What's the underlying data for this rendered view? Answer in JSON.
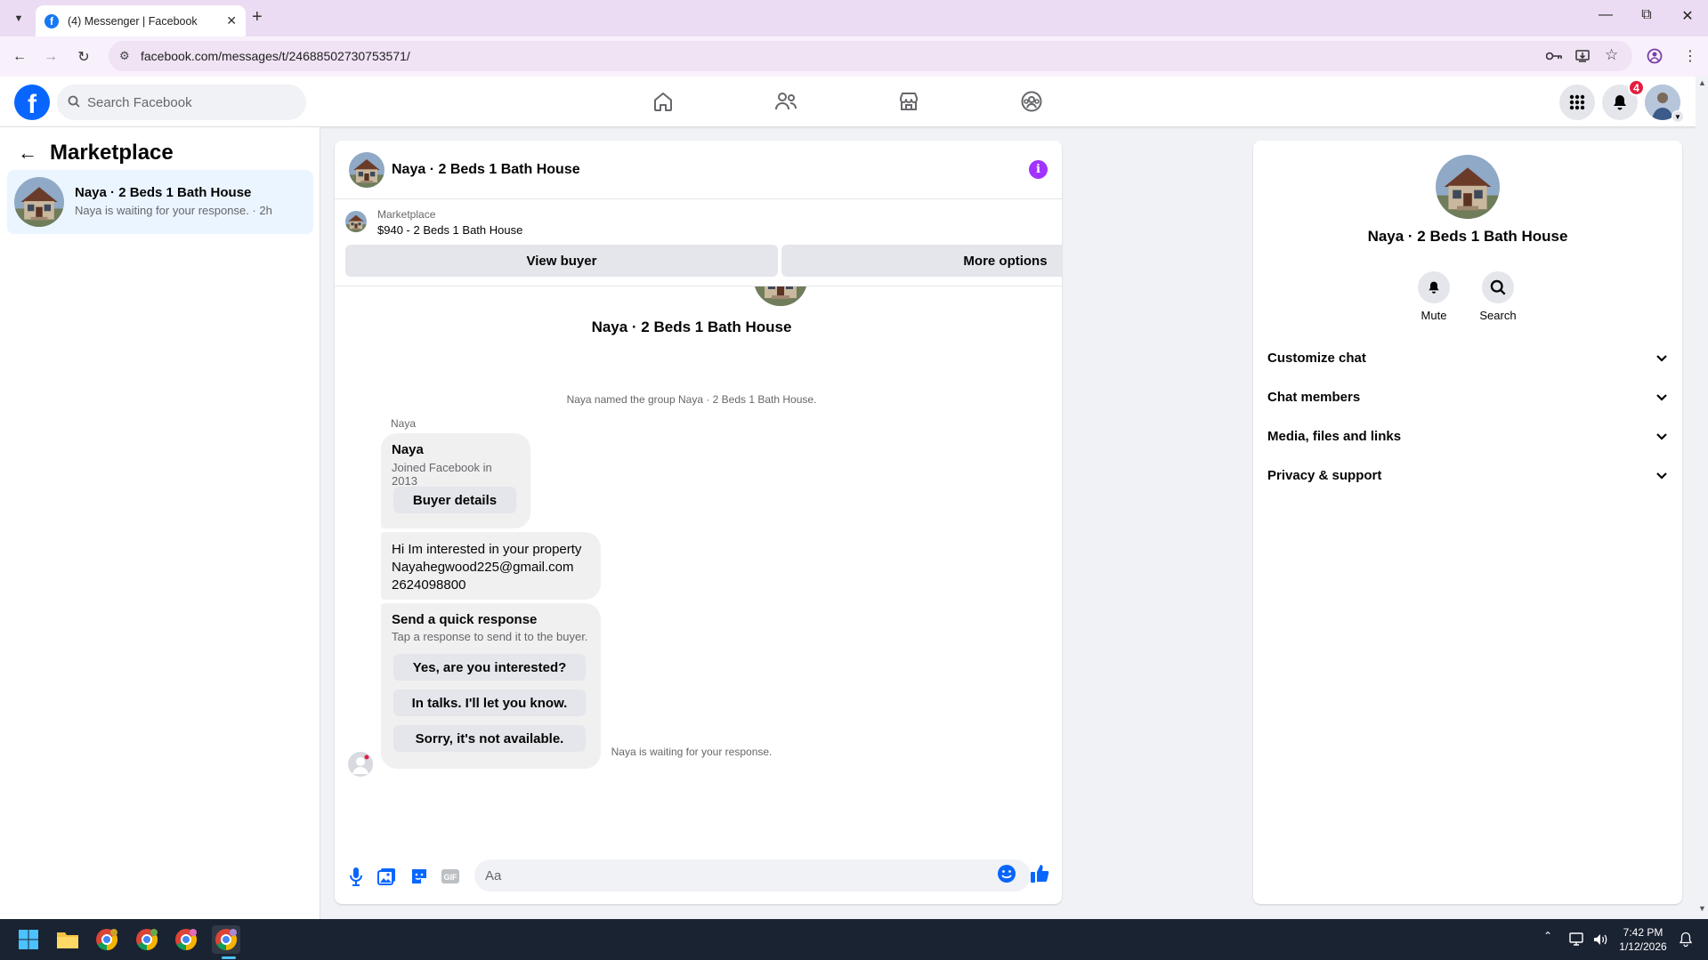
{
  "browser": {
    "tab_title": "(4) Messenger | Facebook",
    "url": "facebook.com/messages/t/24688502730753571/"
  },
  "fb": {
    "logo_letter": "f",
    "search_placeholder": "Search Facebook",
    "notification_count": "4",
    "center_nav": [
      "home-icon",
      "friends-icon",
      "marketplace-icon",
      "groups-icon"
    ]
  },
  "sidebar": {
    "title": "Marketplace",
    "conversations": [
      {
        "name": "Naya · 2 Beds 1 Bath House",
        "preview": "Naya is waiting for your response. · 2h"
      }
    ]
  },
  "chat": {
    "title": "Naya · 2 Beds 1 Bath House",
    "marketplace_label": "Marketplace",
    "listing": "$940 - 2 Beds 1 Bath House",
    "view_buyer": "View buyer",
    "more_options": "More options",
    "hero_name": "Naya · 2 Beds 1 Bath House",
    "system_named": "Naya named the group Naya · 2 Beds 1 Bath House.",
    "sender": "Naya",
    "profile_card": {
      "name": "Naya",
      "joined": "Joined Facebook in 2013",
      "button": "Buyer details"
    },
    "message_lines": [
      "Hi Im interested in your property",
      "Nayahegwood225@gmail.com",
      "2624098800"
    ],
    "quick_response": {
      "title": "Send a quick response",
      "subtitle": "Tap a response to send it to the buyer.",
      "options": [
        "Yes, are you interested?",
        "In talks. I'll let you know.",
        "Sorry, it's not available."
      ]
    },
    "waiting": "Naya is waiting for your response.",
    "composer_placeholder": "Aa"
  },
  "details": {
    "name": "Naya · 2 Beds 1 Bath House",
    "actions": [
      {
        "label": "Mute",
        "icon": "bell-icon"
      },
      {
        "label": "Search",
        "icon": "search-icon"
      }
    ],
    "sections": [
      "Customize chat",
      "Chat members",
      "Media, files and links",
      "Privacy & support"
    ]
  },
  "taskbar": {
    "time": "7:42 PM",
    "date": "1/12/2026"
  },
  "colors": {
    "fb_blue": "#0866ff",
    "messenger_accent": "#a033ff",
    "selected_row": "#ebf5ff",
    "badge_red": "#e41e3f"
  }
}
